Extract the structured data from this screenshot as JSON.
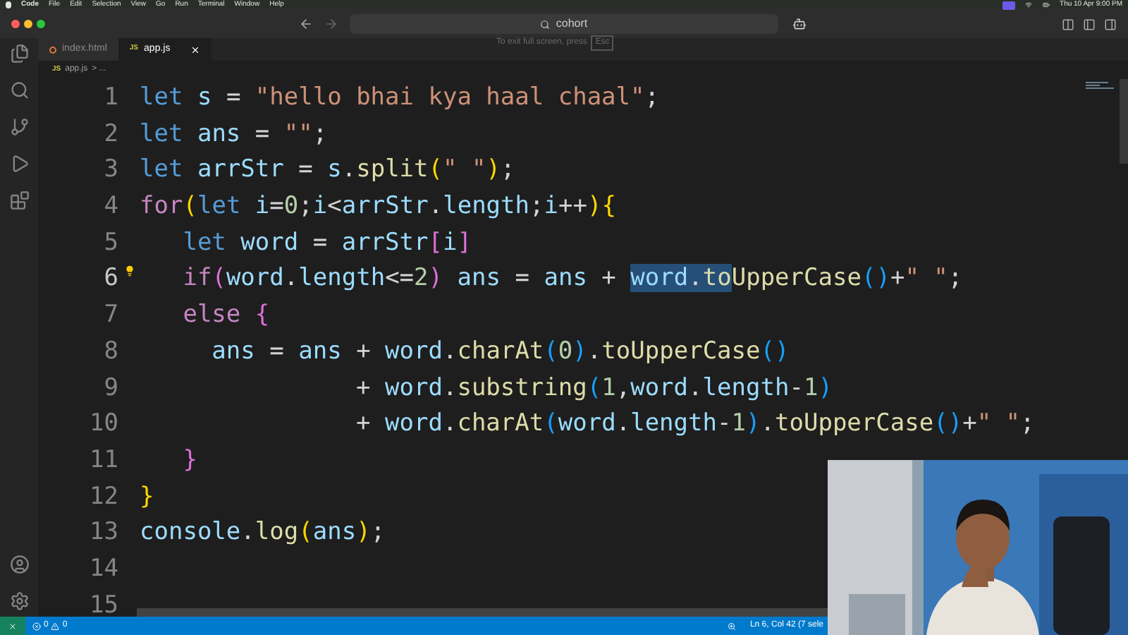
{
  "menu_bar": {
    "app": "Code",
    "items": [
      "File",
      "Edit",
      "Selection",
      "View",
      "Go",
      "Run",
      "Terminal",
      "Window",
      "Help"
    ],
    "clock": "Thu 10 Apr 9:00 PM"
  },
  "title_bar": {
    "search": "cohort"
  },
  "fullscreen_hint": {
    "text": "To exit full screen, press",
    "key": "Esc"
  },
  "tabs": [
    {
      "label": "index.html",
      "kind": "html",
      "selected": false
    },
    {
      "label": "app.js",
      "kind": "js",
      "badge": "JS",
      "selected": true
    }
  ],
  "breadcrumb": {
    "badge": "JS",
    "file": "app.js",
    "trail": "> ..."
  },
  "editor": {
    "lines": [
      {
        "number": "1",
        "lightbulb": false,
        "tokens": [
          {
            "text": "let ",
            "kind": "kw",
            "selected": false
          },
          {
            "text": "s",
            "kind": "var",
            "selected": false
          },
          {
            "text": " = ",
            "kind": "op",
            "selected": false
          },
          {
            "text": "\"hello bhai kya haal chaal\"",
            "kind": "str",
            "selected": false
          },
          {
            "text": ";",
            "kind": "op",
            "selected": false
          }
        ]
      },
      {
        "number": "2",
        "lightbulb": false,
        "tokens": [
          {
            "text": "let ",
            "kind": "kw",
            "selected": false
          },
          {
            "text": "ans",
            "kind": "var",
            "selected": false
          },
          {
            "text": " = ",
            "kind": "op",
            "selected": false
          },
          {
            "text": "\"\"",
            "kind": "str",
            "selected": false
          },
          {
            "text": ";",
            "kind": "op",
            "selected": false
          }
        ]
      },
      {
        "number": "3",
        "lightbulb": false,
        "tokens": [
          {
            "text": "let ",
            "kind": "kw",
            "selected": false
          },
          {
            "text": "arrStr",
            "kind": "var",
            "selected": false
          },
          {
            "text": " = ",
            "kind": "op",
            "selected": false
          },
          {
            "text": "s",
            "kind": "var",
            "selected": false
          },
          {
            "text": ".",
            "kind": "op",
            "selected": false
          },
          {
            "text": "split",
            "kind": "fn",
            "selected": false
          },
          {
            "text": "(",
            "kind": "brace1",
            "selected": false
          },
          {
            "text": "\" \"",
            "kind": "str",
            "selected": false
          },
          {
            "text": ")",
            "kind": "brace1",
            "selected": false
          },
          {
            "text": ";",
            "kind": "op",
            "selected": false
          }
        ]
      },
      {
        "number": "4",
        "lightbulb": false,
        "tokens": [
          {
            "text": "for",
            "kind": "ctrl",
            "selected": false
          },
          {
            "text": "(",
            "kind": "brace1",
            "selected": false
          },
          {
            "text": "let ",
            "kind": "kw",
            "selected": false
          },
          {
            "text": "i",
            "kind": "var",
            "selected": false
          },
          {
            "text": "=",
            "kind": "op",
            "selected": false
          },
          {
            "text": "0",
            "kind": "num",
            "selected": false
          },
          {
            "text": ";",
            "kind": "op",
            "selected": false
          },
          {
            "text": "i",
            "kind": "var",
            "selected": false
          },
          {
            "text": "<",
            "kind": "op",
            "selected": false
          },
          {
            "text": "arrStr",
            "kind": "var",
            "selected": false
          },
          {
            "text": ".",
            "kind": "op",
            "selected": false
          },
          {
            "text": "length",
            "kind": "var",
            "selected": false
          },
          {
            "text": ";",
            "kind": "op",
            "selected": false
          },
          {
            "text": "i",
            "kind": "var",
            "selected": false
          },
          {
            "text": "++",
            "kind": "op",
            "selected": false
          },
          {
            "text": ")",
            "kind": "brace1",
            "selected": false
          },
          {
            "text": "{",
            "kind": "brace1",
            "selected": false
          }
        ]
      },
      {
        "number": "5",
        "lightbulb": false,
        "tokens": [
          {
            "text": "   let ",
            "kind": "kw",
            "selected": false
          },
          {
            "text": "word",
            "kind": "var",
            "selected": false
          },
          {
            "text": " = ",
            "kind": "op",
            "selected": false
          },
          {
            "text": "arrStr",
            "kind": "var",
            "selected": false
          },
          {
            "text": "[",
            "kind": "brace2",
            "selected": false
          },
          {
            "text": "i",
            "kind": "var",
            "selected": false
          },
          {
            "text": "]",
            "kind": "brace2",
            "selected": false
          }
        ]
      },
      {
        "number": "6",
        "lightbulb": true,
        "tokens": [
          {
            "text": "   if",
            "kind": "ctrl",
            "selected": false
          },
          {
            "text": "(",
            "kind": "brace2",
            "selected": false
          },
          {
            "text": "word",
            "kind": "var",
            "selected": false
          },
          {
            "text": ".",
            "kind": "op",
            "selected": false
          },
          {
            "text": "length",
            "kind": "var",
            "selected": false
          },
          {
            "text": "<=",
            "kind": "op",
            "selected": false
          },
          {
            "text": "2",
            "kind": "num",
            "selected": false
          },
          {
            "text": ")",
            "kind": "brace2",
            "selected": false
          },
          {
            "text": " ans",
            "kind": "var",
            "selected": false
          },
          {
            "text": " = ",
            "kind": "op",
            "selected": false
          },
          {
            "text": "ans",
            "kind": "var",
            "selected": false
          },
          {
            "text": " + ",
            "kind": "op",
            "selected": false
          },
          {
            "text": "word",
            "kind": "var",
            "selected": true
          },
          {
            "text": ".",
            "kind": "op",
            "selected": true
          },
          {
            "text": "to",
            "kind": "fn",
            "selected": true
          },
          {
            "text": "UpperCase",
            "kind": "fn",
            "selected": false
          },
          {
            "text": "()",
            "kind": "brace3",
            "selected": false
          },
          {
            "text": "+",
            "kind": "op",
            "selected": false
          },
          {
            "text": "\" \"",
            "kind": "str",
            "selected": false
          },
          {
            "text": ";",
            "kind": "op",
            "selected": false
          }
        ]
      },
      {
        "number": "7",
        "lightbulb": false,
        "tokens": [
          {
            "text": "   else ",
            "kind": "ctrl",
            "selected": false
          },
          {
            "text": "{",
            "kind": "brace2",
            "selected": false
          }
        ]
      },
      {
        "number": "8",
        "lightbulb": false,
        "tokens": [
          {
            "text": "     ans",
            "kind": "var",
            "selected": false
          },
          {
            "text": " = ",
            "kind": "op",
            "selected": false
          },
          {
            "text": "ans",
            "kind": "var",
            "selected": false
          },
          {
            "text": " + ",
            "kind": "op",
            "selected": false
          },
          {
            "text": "word",
            "kind": "var",
            "selected": false
          },
          {
            "text": ".",
            "kind": "op",
            "selected": false
          },
          {
            "text": "charAt",
            "kind": "fn",
            "selected": false
          },
          {
            "text": "(",
            "kind": "brace3",
            "selected": false
          },
          {
            "text": "0",
            "kind": "num",
            "selected": false
          },
          {
            "text": ")",
            "kind": "brace3",
            "selected": false
          },
          {
            "text": ".",
            "kind": "op",
            "selected": false
          },
          {
            "text": "toUpperCase",
            "kind": "fn",
            "selected": false
          },
          {
            "text": "()",
            "kind": "brace3",
            "selected": false
          }
        ]
      },
      {
        "number": "9",
        "lightbulb": false,
        "tokens": [
          {
            "text": "               + ",
            "kind": "op",
            "selected": false
          },
          {
            "text": "word",
            "kind": "var",
            "selected": false
          },
          {
            "text": ".",
            "kind": "op",
            "selected": false
          },
          {
            "text": "substring",
            "kind": "fn",
            "selected": false
          },
          {
            "text": "(",
            "kind": "brace3",
            "selected": false
          },
          {
            "text": "1",
            "kind": "num",
            "selected": false
          },
          {
            "text": ",",
            "kind": "op",
            "selected": false
          },
          {
            "text": "word",
            "kind": "var",
            "selected": false
          },
          {
            "text": ".",
            "kind": "op",
            "selected": false
          },
          {
            "text": "length",
            "kind": "var",
            "selected": false
          },
          {
            "text": "-",
            "kind": "op",
            "selected": false
          },
          {
            "text": "1",
            "kind": "num",
            "selected": false
          },
          {
            "text": ")",
            "kind": "brace3",
            "selected": false
          }
        ]
      },
      {
        "number": "10",
        "lightbulb": false,
        "tokens": [
          {
            "text": "               + ",
            "kind": "op",
            "selected": false
          },
          {
            "text": "word",
            "kind": "var",
            "selected": false
          },
          {
            "text": ".",
            "kind": "op",
            "selected": false
          },
          {
            "text": "charAt",
            "kind": "fn",
            "selected": false
          },
          {
            "text": "(",
            "kind": "brace3",
            "selected": false
          },
          {
            "text": "word",
            "kind": "var",
            "selected": false
          },
          {
            "text": ".",
            "kind": "op",
            "selected": false
          },
          {
            "text": "length",
            "kind": "var",
            "selected": false
          },
          {
            "text": "-",
            "kind": "op",
            "selected": false
          },
          {
            "text": "1",
            "kind": "num",
            "selected": false
          },
          {
            "text": ")",
            "kind": "brace3",
            "selected": false
          },
          {
            "text": ".",
            "kind": "op",
            "selected": false
          },
          {
            "text": "toUpperCase",
            "kind": "fn",
            "selected": false
          },
          {
            "text": "()",
            "kind": "brace3",
            "selected": false
          },
          {
            "text": "+",
            "kind": "op",
            "selected": false
          },
          {
            "text": "\" \"",
            "kind": "str",
            "selected": false
          },
          {
            "text": ";",
            "kind": "op",
            "selected": false
          }
        ]
      },
      {
        "number": "11",
        "lightbulb": false,
        "tokens": [
          {
            "text": "   }",
            "kind": "brace2",
            "selected": false
          }
        ]
      },
      {
        "number": "12",
        "lightbulb": false,
        "tokens": [
          {
            "text": "}",
            "kind": "brace1",
            "selected": false
          }
        ]
      },
      {
        "number": "13",
        "lightbulb": false,
        "tokens": [
          {
            "text": "console",
            "kind": "var",
            "selected": false
          },
          {
            "text": ".",
            "kind": "op",
            "selected": false
          },
          {
            "text": "log",
            "kind": "fn",
            "selected": false
          },
          {
            "text": "(",
            "kind": "brace1",
            "selected": false
          },
          {
            "text": "ans",
            "kind": "var",
            "selected": false
          },
          {
            "text": ")",
            "kind": "brace1",
            "selected": false
          },
          {
            "text": ";",
            "kind": "op",
            "selected": false
          }
        ]
      },
      {
        "number": "14",
        "lightbulb": false
      },
      {
        "number": "15",
        "lightbulb": false
      }
    ]
  },
  "status_bar": {
    "errors": "0",
    "warnings": "0",
    "position": "Ln 6, Col 42 (7 sele"
  }
}
